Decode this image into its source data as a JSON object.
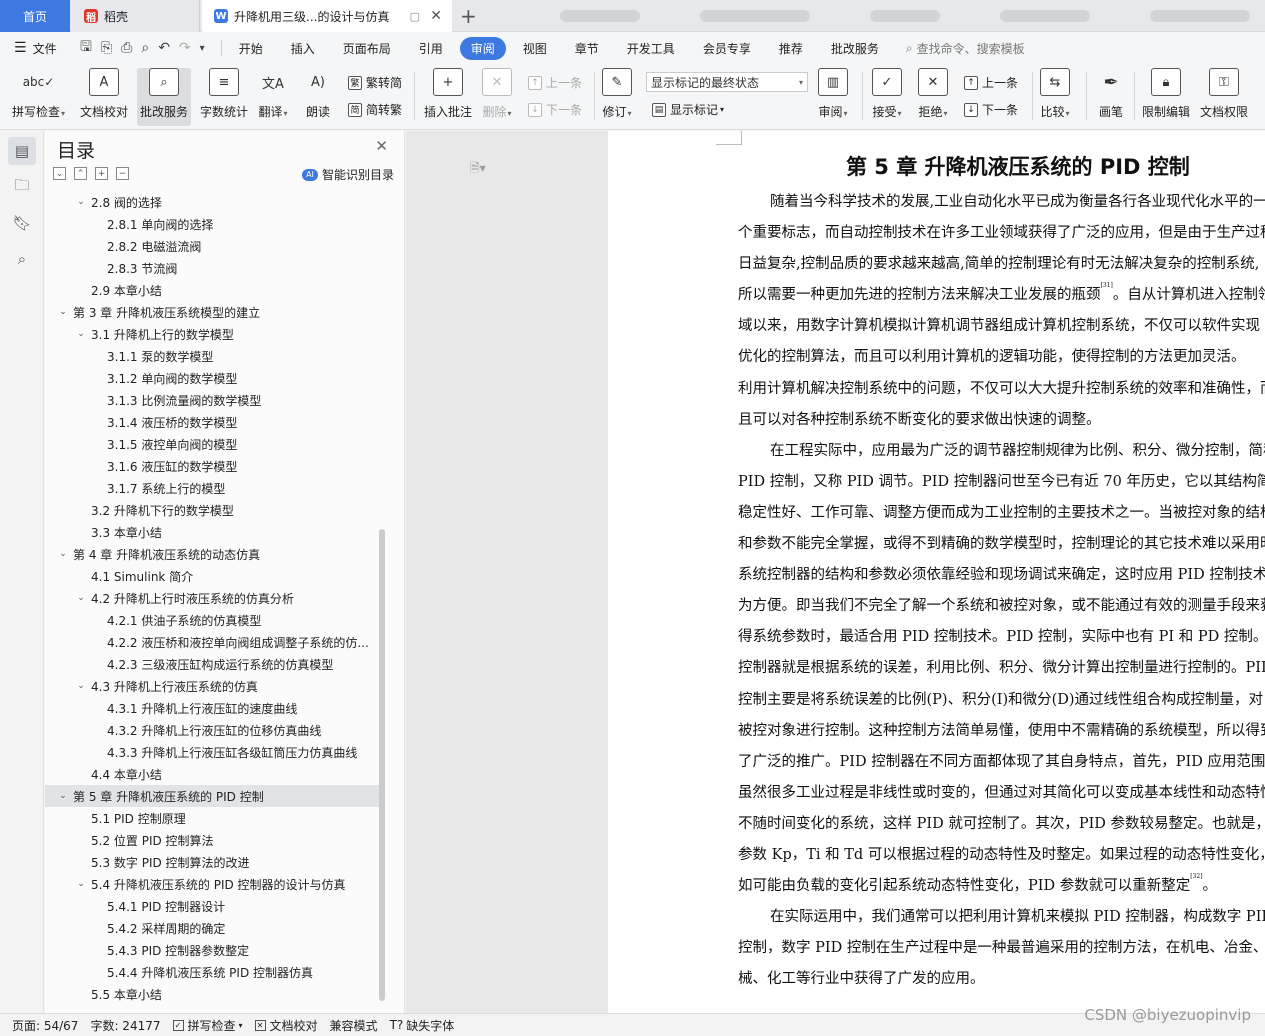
{
  "tabs": {
    "home": "首页",
    "daoke": "稻壳",
    "doc": "升降机用三级...的设计与仿真",
    "add": "+",
    "close": "✕",
    "pin": "▢"
  },
  "menu": {
    "file": "文件",
    "items": [
      "开始",
      "插入",
      "页面布局",
      "引用",
      "审阅",
      "视图",
      "章节",
      "开发工具",
      "会员专享",
      "推荐",
      "批改服务"
    ],
    "active": "审阅",
    "search": "查找命令、搜索模板"
  },
  "ribbon": {
    "spell_check": "拼写检查",
    "doc_proof": "文档校对",
    "review_service": "批改服务",
    "word_count": "字数统计",
    "translate": "翻译",
    "read_aloud": "朗读",
    "trad_conv": "繁转简",
    "simp_conv": "简转繁",
    "insert_comment": "插入批注",
    "delete": "删除",
    "prev_comment": "上一条",
    "next_comment": "下一条",
    "track": "修订",
    "markup_select": "显示标记的最终状态",
    "show_markup": "显示标记",
    "review_pane": "审阅",
    "accept": "接受",
    "reject": "拒绝",
    "prev_change": "上一条",
    "next_change": "下一条",
    "compare": "比较",
    "ink": "画笔",
    "restrict_edit": "限制编辑",
    "doc_rights": "文档权限"
  },
  "toc": {
    "title": "目录",
    "smart_label": "智能识别目录",
    "items": [
      {
        "level": 2,
        "arrow": "down",
        "text": "2.8  阀的选择"
      },
      {
        "level": 3,
        "arrow": "",
        "text": "2.8.1  单向阀的选择"
      },
      {
        "level": 3,
        "arrow": "",
        "text": "2.8.2  电磁溢流阀"
      },
      {
        "level": 3,
        "arrow": "",
        "text": "2.8.3  节流阀"
      },
      {
        "level": 2,
        "arrow": "",
        "text": "2.9  本章小结"
      },
      {
        "level": 1,
        "arrow": "down",
        "text": "第 3 章  升降机液压系统模型的建立"
      },
      {
        "level": 2,
        "arrow": "down",
        "text": "3.1 升降机上行的数学模型"
      },
      {
        "level": 3,
        "arrow": "",
        "text": "3.1.1  泵的数学模型"
      },
      {
        "level": 3,
        "arrow": "",
        "text": "3.1.2  单向阀的数学模型"
      },
      {
        "level": 3,
        "arrow": "",
        "text": "3.1.3  比例流量阀的数学模型"
      },
      {
        "level": 3,
        "arrow": "",
        "text": "3.1.4  液压桥的数学模型"
      },
      {
        "level": 3,
        "arrow": "",
        "text": "3.1.5  液控单向阀的模型"
      },
      {
        "level": 3,
        "arrow": "",
        "text": "3.1.6  液压缸的数学模型"
      },
      {
        "level": 3,
        "arrow": "",
        "text": "3.1.7  系统上行的模型"
      },
      {
        "level": 2,
        "arrow": "",
        "text": "3.2  升降机下行的数学模型"
      },
      {
        "level": 2,
        "arrow": "",
        "text": "3.3  本章小结"
      },
      {
        "level": 1,
        "arrow": "down",
        "text": "第 4 章  升降机液压系统的动态仿真"
      },
      {
        "level": 2,
        "arrow": "",
        "text": "4.1 Simulink 简介"
      },
      {
        "level": 2,
        "arrow": "down",
        "text": "4.2 升降机上行时液压系统的仿真分析"
      },
      {
        "level": 3,
        "arrow": "",
        "text": "4.2.1  供油子系统的仿真模型"
      },
      {
        "level": 3,
        "arrow": "",
        "text": "4.2.2  液压桥和液控单向阀组成调整子系统的仿..."
      },
      {
        "level": 3,
        "arrow": "",
        "text": "4.2.3  三级液压缸构成运行系统的仿真模型"
      },
      {
        "level": 2,
        "arrow": "down",
        "text": "4.3  升降机上行液压系统的仿真"
      },
      {
        "level": 3,
        "arrow": "",
        "text": "4.3.1  升降机上行液压缸的速度曲线"
      },
      {
        "level": 3,
        "arrow": "",
        "text": "4.3.2  升降机上行液压缸的位移仿真曲线"
      },
      {
        "level": 3,
        "arrow": "",
        "text": "4.3.3  升降机上行液压缸各级缸筒压力仿真曲线"
      },
      {
        "level": 2,
        "arrow": "",
        "text": "4.4  本章小结"
      },
      {
        "level": 1,
        "arrow": "down",
        "text": "第 5 章  升降机液压系统的 PID 控制",
        "selected": true
      },
      {
        "level": 2,
        "arrow": "",
        "text": "5.1 PID 控制原理"
      },
      {
        "level": 2,
        "arrow": "",
        "text": "5.2  位置 PID 控制算法"
      },
      {
        "level": 2,
        "arrow": "",
        "text": "5.3  数字 PID 控制算法的改进"
      },
      {
        "level": 2,
        "arrow": "down",
        "text": "5.4  升降机液压系统的 PID 控制器的设计与仿真"
      },
      {
        "level": 3,
        "arrow": "",
        "text": "5.4.1 PID 控制器设计"
      },
      {
        "level": 3,
        "arrow": "",
        "text": "5.4.2  采样周期的确定"
      },
      {
        "level": 3,
        "arrow": "",
        "text": "5.4.3 PID 控制器参数整定"
      },
      {
        "level": 3,
        "arrow": "",
        "text": "5.4.4  升降机液压系统 PID 控制器仿真"
      },
      {
        "level": 2,
        "arrow": "",
        "text": "5.5  本章小结"
      }
    ]
  },
  "doc": {
    "chapter_title": "第 5 章  升降机液压系统的 PID 控制",
    "lines": [
      {
        "indent": true,
        "text": "随着当今科学技术的发展,工业自动化水平已成为衡量各行各业现代化水平的一"
      },
      {
        "indent": false,
        "text": "个重要标志，而自动控制技术在许多工业领域获得了广泛的应用，但是由于生产过程"
      },
      {
        "indent": false,
        "text": "日益复杂,控制品质的要求越来越高,简单的控制理论有时无法解决复杂的控制系统,"
      },
      {
        "indent": false,
        "text": "所以需要一种更加先进的控制方法来解决工业发展的瓶颈",
        "sup": "[31]",
        "after": "。自从计算机进入控制领"
      },
      {
        "indent": false,
        "text": "域以来，用数字计算机模拟计算机调节器组成计算机控制系统，不仅可以软件实现"
      },
      {
        "indent": false,
        "text": "优化的控制算法，而且可以利用计算机的逻辑功能，使得控制的方法更加灵活。"
      },
      {
        "indent": false,
        "text": "利用计算机解决控制系统中的问题，不仅可以大大提升控制系统的效率和准确性，而"
      },
      {
        "indent": false,
        "text": "且可以对各种控制系统不断变化的要求做出快速的调整。"
      },
      {
        "indent": true,
        "text": "在工程实际中，应用最为广泛的调节器控制规律为比例、积分、微分控制，简称"
      },
      {
        "indent": false,
        "text": "PID 控制，又称 PID 调节。PID 控制器问世至今已有近 70 年历史，它以其结构简单、"
      },
      {
        "indent": false,
        "text": "稳定性好、工作可靠、调整方便而成为工业控制的主要技术之一。当被控对象的结构"
      },
      {
        "indent": false,
        "text": "和参数不能完全掌握，或得不到精确的数学模型时，控制理论的其它技术难以采用时，"
      },
      {
        "indent": false,
        "text": "系统控制器的结构和参数必须依靠经验和现场调试来确定，这时应用 PID 控制技术最"
      },
      {
        "indent": false,
        "text": "为方便。即当我们不完全了解一个系统和被控对象，或不能通过有效的测量手段来获"
      },
      {
        "indent": false,
        "text": "得系统参数时，最适合用 PID 控制技术。PID 控制，实际中也有 PI 和 PD 控制。PID"
      },
      {
        "indent": false,
        "text": "控制器就是根据系统的误差，利用比例、积分、微分计算出控制量进行控制的。PID"
      },
      {
        "indent": false,
        "text": "控制主要是将系统误差的比例(P)、积分(I)和微分(D)通过线性组合构成控制量，对"
      },
      {
        "indent": false,
        "text": "被控对象进行控制。这种控制方法简单易懂，使用中不需精确的系统模型，所以得到"
      },
      {
        "indent": false,
        "text": "了广泛的推广。PID 控制器在不同方面都体现了其自身特点，首先，PID 应用范围广。"
      },
      {
        "indent": false,
        "text": "虽然很多工业过程是非线性或时变的，但通过对其简化可以变成基本线性和动态特性"
      },
      {
        "indent": false,
        "text": "不随时间变化的系统，这样 PID 就可控制了。其次，PID 参数较易整定。也就是，PID"
      },
      {
        "indent": false,
        "text": "参数 Kp，Ti 和 Td 可以根据过程的动态特性及时整定。如果过程的动态特性变化，例"
      },
      {
        "indent": false,
        "text": "如可能由负载的变化引起系统动态特性变化，PID 参数就可以重新整定",
        "sup": "[32]",
        "after": "。"
      },
      {
        "indent": true,
        "text": "在实际运用中，我们通常可以把利用计算机来模拟 PID 控制器，构成数字 PID"
      },
      {
        "indent": false,
        "text": "控制，数字 PID 控制在生产过程中是一种最普遍采用的控制方法，在机电、冶金、机"
      },
      {
        "indent": false,
        "text": "械、化工等行业中获得了广发的应用。"
      }
    ]
  },
  "status": {
    "page": "页面: 54/67",
    "words": "字数: 24177",
    "spell": "拼写检查",
    "proof": "文档校对",
    "compat": "兼容模式",
    "missing_font": "缺失字体"
  },
  "watermark": "CSDN @biyezuopinvip",
  "colors": {
    "accent": "#3d79e0",
    "daoke_red": "#e0352b"
  }
}
